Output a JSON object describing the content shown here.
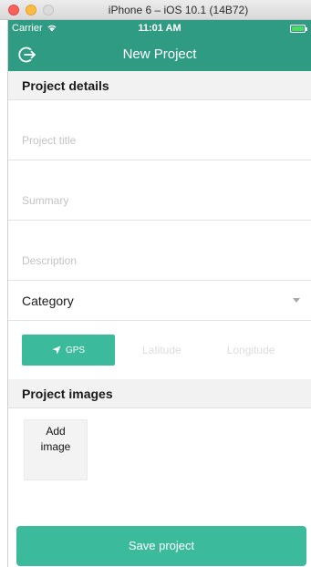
{
  "window": {
    "title": "iPhone 6 – iOS 10.1 (14B72)"
  },
  "status_bar": {
    "carrier": "Carrier",
    "time": "11:01 AM",
    "battery_percent": 100
  },
  "nav": {
    "title": "New Project",
    "back_icon": "logout-arrow-icon"
  },
  "sections": {
    "details_title": "Project details",
    "images_title": "Project images"
  },
  "fields": {
    "title_placeholder": "Project title",
    "summary_placeholder": "Summary",
    "description_placeholder": "Description",
    "title_value": "",
    "summary_value": "",
    "description_value": ""
  },
  "category": {
    "label": "Category"
  },
  "location": {
    "gps_label": "GPS",
    "latitude_placeholder": "Latitude",
    "longitude_placeholder": "Longitude"
  },
  "images": {
    "add_label_line1": "Add",
    "add_label_line2": "image"
  },
  "actions": {
    "save_label": "Save project"
  },
  "colors": {
    "header": "#2e9b82",
    "accent": "#3cbb9c",
    "section_bg": "#f2f2f2"
  }
}
